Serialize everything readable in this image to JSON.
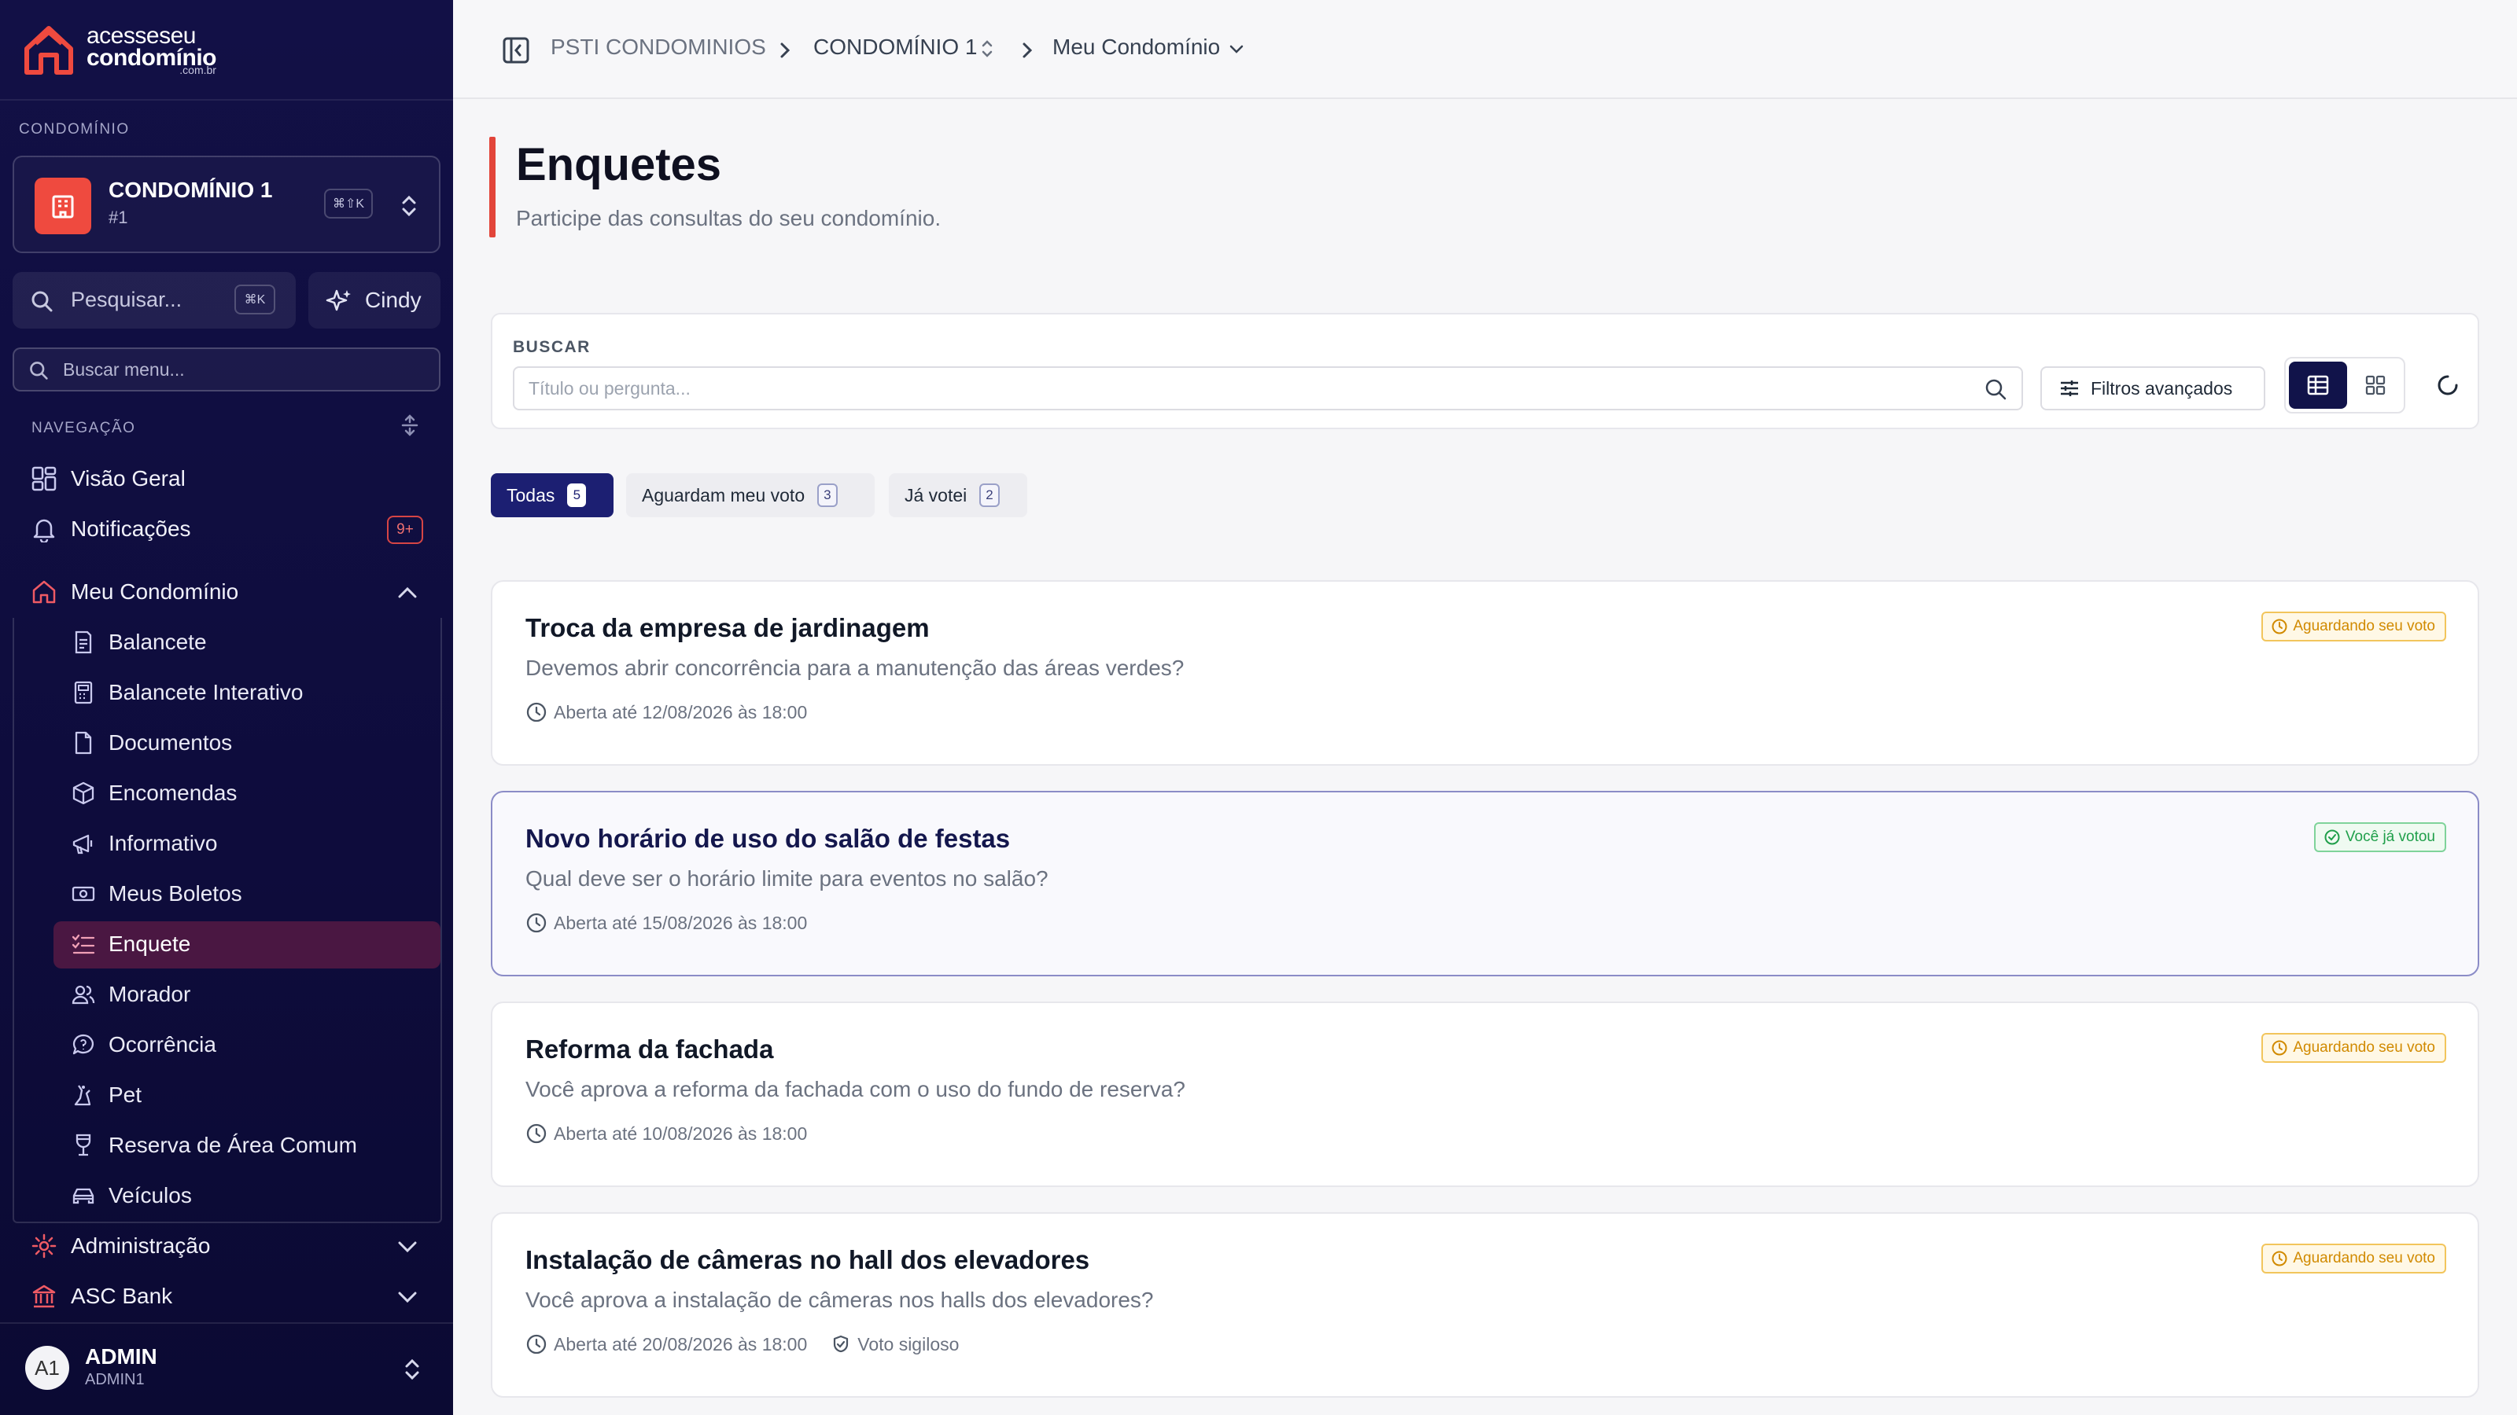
{
  "brand": {
    "line1_bold": "acesse",
    "line1_light": "seu",
    "line2": "condomínio",
    "line3": ".com.br",
    "accent": "#ef4a3f",
    "sidebar_bg": "#121046"
  },
  "sidebar": {
    "section_condominio": "CONDOMÍNIO",
    "condo": {
      "name": "CONDOMÍNIO 1",
      "number": "#1",
      "shortcut": "⌘⇧K"
    },
    "search": {
      "placeholder": "Pesquisar...",
      "shortcut": "⌘K"
    },
    "assistant": {
      "label": "Cindy"
    },
    "menu_search": {
      "placeholder": "Buscar menu..."
    },
    "section_nav": "NAVEGAÇÃO",
    "items": [
      {
        "label": "Visão Geral",
        "icon": "grid-icon"
      },
      {
        "label": "Notificações",
        "icon": "bell-icon",
        "badge": "9+"
      },
      {
        "label": "Meu Condomínio",
        "icon": "home-icon",
        "expanded": true
      }
    ],
    "sub_items": [
      {
        "label": "Balancete",
        "icon": "receipt-icon"
      },
      {
        "label": "Balancete Interativo",
        "icon": "calculator-icon"
      },
      {
        "label": "Documentos",
        "icon": "document-icon"
      },
      {
        "label": "Encomendas",
        "icon": "package-icon"
      },
      {
        "label": "Informativo",
        "icon": "megaphone-icon"
      },
      {
        "label": "Meus Boletos",
        "icon": "banknote-icon"
      },
      {
        "label": "Enquete",
        "icon": "list-checks-icon",
        "active": true
      },
      {
        "label": "Morador",
        "icon": "users-icon"
      },
      {
        "label": "Ocorrência",
        "icon": "message-icon"
      },
      {
        "label": "Pet",
        "icon": "paw-icon"
      },
      {
        "label": "Reserva de Área Comum",
        "icon": "glass-icon"
      },
      {
        "label": "Veículos",
        "icon": "car-icon"
      }
    ],
    "bottom_items": [
      {
        "label": "Administração",
        "icon": "gear-icon"
      },
      {
        "label": "ASC Bank",
        "icon": "bank-icon"
      }
    ],
    "user": {
      "initials": "A1",
      "name": "ADMIN",
      "login": "ADMIN1"
    }
  },
  "breadcrumb": {
    "root": "PSTI CONDOMINIOS",
    "condo": "CONDOMÍNIO 1",
    "section": "Meu Condomínio"
  },
  "page": {
    "title": "Enquetes",
    "subtitle": "Participe das consultas do seu condomínio."
  },
  "filters": {
    "label": "BUSCAR",
    "placeholder": "Título ou pergunta...",
    "advanced_label": "Filtros avançados"
  },
  "tabs": [
    {
      "label": "Todas",
      "count": "5",
      "active": true
    },
    {
      "label": "Aguardam meu voto",
      "count": "3",
      "active": false
    },
    {
      "label": "Já votei",
      "count": "2",
      "active": false
    }
  ],
  "polls": [
    {
      "title": "Troca da empresa de jardinagem",
      "question": "Devemos abrir concorrência para a manutenção das áreas verdes?",
      "deadline": "Aberta até 12/08/2026 às 18:00",
      "status": "Aguardando seu voto",
      "voted": false
    },
    {
      "title": "Novo horário de uso do salão de festas",
      "question": "Qual deve ser o horário limite para eventos no salão?",
      "deadline": "Aberta até 15/08/2026 às 18:00",
      "status": "Você já votou",
      "voted": true
    },
    {
      "title": "Reforma da fachada",
      "question": "Você aprova a reforma da fachada com o uso do fundo de reserva?",
      "deadline": "Aberta até 10/08/2026 às 18:00",
      "status": "Aguardando seu voto",
      "voted": false
    },
    {
      "title": "Instalação de câmeras no hall dos elevadores",
      "question": "Você aprova a instalação de câmeras nos halls dos elevadores?",
      "deadline": "Aberta até 20/08/2026 às 18:00",
      "status": "Aguardando seu voto",
      "voted": false,
      "secret_label": "Voto sigiloso"
    }
  ]
}
